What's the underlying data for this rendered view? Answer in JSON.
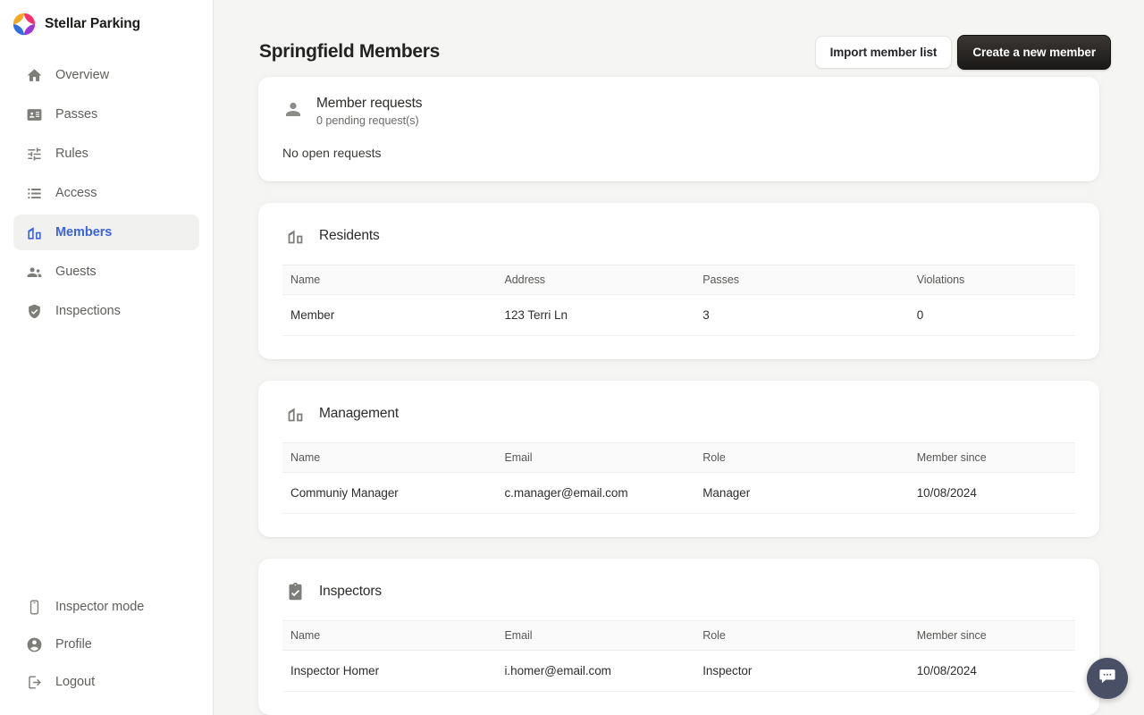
{
  "brand": {
    "name": "Stellar Parking",
    "logo_icon": "stellar-pinwheel-logo"
  },
  "sidebar": {
    "top_items": [
      {
        "label": "Overview",
        "icon": "home-icon",
        "active": false
      },
      {
        "label": "Passes",
        "icon": "badge-icon",
        "active": false
      },
      {
        "label": "Rules",
        "icon": "tune-icon",
        "active": false
      },
      {
        "label": "Access",
        "icon": "list-icon",
        "active": false
      },
      {
        "label": "Members",
        "icon": "apartment-icon",
        "active": true
      },
      {
        "label": "Guests",
        "icon": "people-icon",
        "active": false
      },
      {
        "label": "Inspections",
        "icon": "shield-check-icon",
        "active": false
      }
    ],
    "bottom_items": [
      {
        "label": "Inspector mode",
        "icon": "phone-icon"
      },
      {
        "label": "Profile",
        "icon": "account-circle-icon"
      },
      {
        "label": "Logout",
        "icon": "logout-icon"
      }
    ],
    "active_color": "#3b63e0"
  },
  "header": {
    "title": "Springfield Members",
    "import_label": "Import member list",
    "create_label": "Create a new member"
  },
  "member_requests": {
    "icon": "person-icon",
    "title": "Member requests",
    "subtitle": "0 pending request(s)",
    "empty_text": "No open requests"
  },
  "sections": [
    {
      "title": "Residents",
      "icon": "apartment-icon",
      "columns": [
        "Name",
        "Address",
        "Passes",
        "Violations"
      ],
      "rows": [
        [
          "Member",
          "123 Terri Ln",
          "3",
          "0"
        ]
      ]
    },
    {
      "title": "Management",
      "icon": "apartment-icon",
      "columns": [
        "Name",
        "Email",
        "Role",
        "Member since"
      ],
      "rows": [
        [
          "Communiy Manager",
          "c.manager@email.com",
          "Manager",
          "10/08/2024"
        ]
      ]
    },
    {
      "title": "Inspectors",
      "icon": "assignment-turned-in-icon",
      "columns": [
        "Name",
        "Email",
        "Role",
        "Member since"
      ],
      "rows": [
        [
          "Inspector Homer",
          "i.homer@email.com",
          "Inspector",
          "10/08/2024"
        ]
      ]
    }
  ],
  "chat": {
    "icon": "chat-bubble-icon",
    "color": "#495065"
  }
}
